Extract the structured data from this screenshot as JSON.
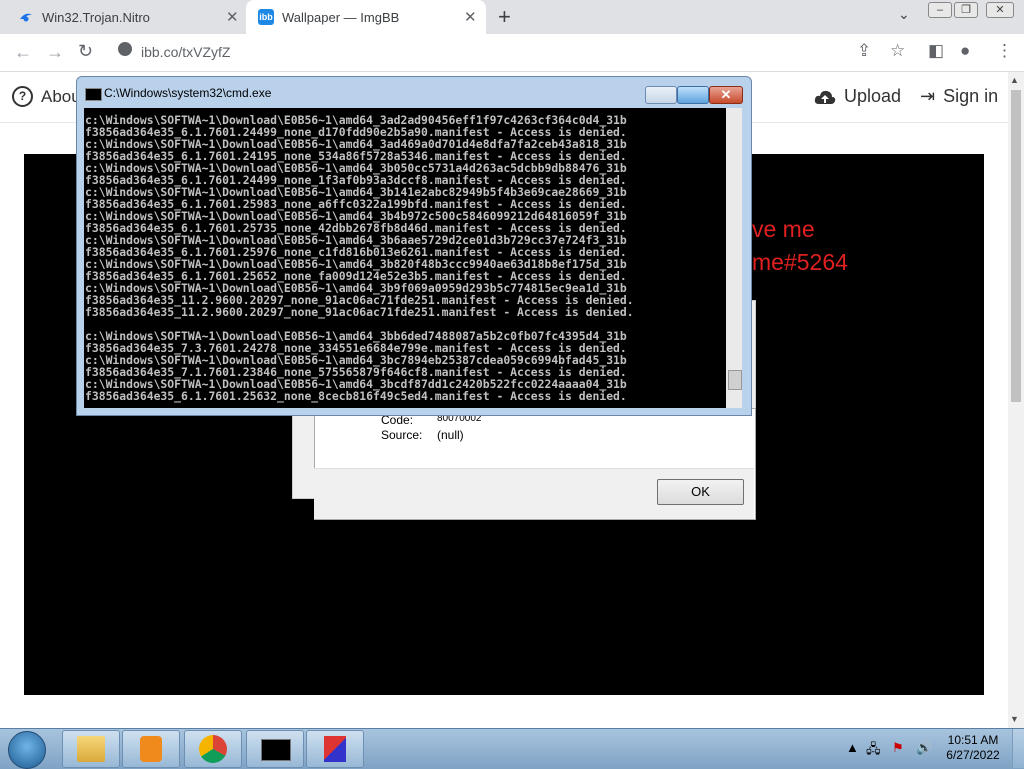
{
  "browser": {
    "tabs": [
      {
        "title": "Win32.Trojan.Nitro",
        "active": false
      },
      {
        "title": "Wallpaper — ImgBB",
        "active": true
      }
    ],
    "url": "ibb.co/txVZyfZ"
  },
  "page": {
    "nav": {
      "about": "About",
      "upload": "Upload",
      "signin": "Sign in"
    },
    "red_text": [
      "ve me",
      "me#5264"
    ]
  },
  "error_dialog": {
    "code_label": "Code:",
    "code_value": "80070002",
    "source_label": "Source:",
    "source_value": "(null)",
    "ok_label": "OK"
  },
  "cmd": {
    "title": "C:\\Windows\\system32\\cmd.exe",
    "lines": [
      "c:\\Windows\\SOFTWA~1\\Download\\E0B56~1\\amd64_3ad2ad90456eff1f97c4263cf364c0d4_31b",
      "f3856ad364e35_6.1.7601.24499_none_d170fdd90e2b5a90.manifest - Access is denied.",
      "c:\\Windows\\SOFTWA~1\\Download\\E0B56~1\\amd64_3ad469a0d701d4e8dfa7fa2ceb43a818_31b",
      "f3856ad364e35_6.1.7601.24195_none_534a86f5728a5346.manifest - Access is denied.",
      "c:\\Windows\\SOFTWA~1\\Download\\E0B56~1\\amd64_3b050cc5731a4d263ac5dcbb9db88476_31b",
      "f3856ad364e35_6.1.7601.24499_none_1f3af0b93a3dccf8.manifest - Access is denied.",
      "c:\\Windows\\SOFTWA~1\\Download\\E0B56~1\\amd64_3b141e2abc82949b5f4b3e69cae28669_31b",
      "f3856ad364e35_6.1.7601.25983_none_a6ffc0322a199bfd.manifest - Access is denied.",
      "c:\\Windows\\SOFTWA~1\\Download\\E0B56~1\\amd64_3b4b972c500c5846099212d64816059f_31b",
      "f3856ad364e35_6.1.7601.25735_none_42dbb2678fb8d46d.manifest - Access is denied.",
      "c:\\Windows\\SOFTWA~1\\Download\\E0B56~1\\amd64_3b6aae5729d2ce01d3b729cc37e724f3_31b",
      "f3856ad364e35_6.1.7601.25976_none_c1fd816b013e6261.manifest - Access is denied.",
      "c:\\Windows\\SOFTWA~1\\Download\\E0B56~1\\amd64_3b820f48b3ccc9940ae63d18b8ef175d_31b",
      "f3856ad364e35_6.1.7601.25652_none_fa009d124e52e3b5.manifest - Access is denied.",
      "c:\\Windows\\SOFTWA~1\\Download\\E0B56~1\\amd64_3b9f069a0959d293b5c774815ec9ea1d_31b",
      "f3856ad364e35_11.2.9600.20297_none_91ac06ac71fde251.manifest - Access is denied.",
      "f3856ad364e35_11.2.9600.20297_none_91ac06ac71fde251.manifest - Access is denied.",
      "",
      "c:\\Windows\\SOFTWA~1\\Download\\E0B56~1\\amd64_3bb6ded7488087a5b2c0fb07fc4395d4_31b",
      "f3856ad364e35_7.3.7601.24278_none_334551e6684e799e.manifest - Access is denied.",
      "c:\\Windows\\SOFTWA~1\\Download\\E0B56~1\\amd64_3bc7894eb25387cdea059c6994bfad45_31b",
      "f3856ad364e35_7.1.7601.23846_none_575565879f646cf8.manifest - Access is denied.",
      "c:\\Windows\\SOFTWA~1\\Download\\E0B56~1\\amd64_3bcdf87dd1c2420b522fcc0224aaaa04_31b",
      "f3856ad364e35_6.1.7601.25632_none_8cecb816f49c5ed4.manifest - Access is denied."
    ]
  },
  "taskbar": {
    "time": "10:51 AM",
    "date": "6/27/2022"
  }
}
